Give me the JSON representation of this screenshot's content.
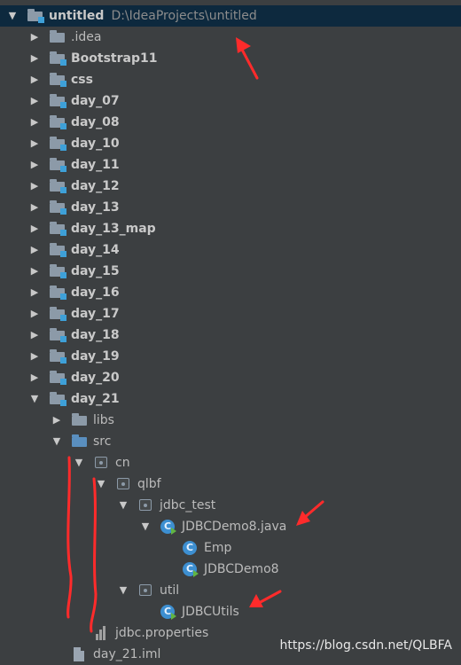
{
  "project": {
    "name": "untitled",
    "path": "D:\\IdeaProjects\\untitled"
  },
  "rows": [
    {
      "label": "untitled",
      "path": "D:\\IdeaProjects\\untitled",
      "depth": 0,
      "expanded": true,
      "icon": "module-folder-icon",
      "bold": true,
      "selected": true
    },
    {
      "label": ".idea",
      "depth": 1,
      "expanded": false,
      "icon": "folder-icon",
      "bold": false
    },
    {
      "label": "Bootstrap11",
      "depth": 1,
      "expanded": false,
      "icon": "module-folder-icon",
      "bold": true
    },
    {
      "label": "css",
      "depth": 1,
      "expanded": false,
      "icon": "module-folder-icon",
      "bold": true
    },
    {
      "label": "day_07",
      "depth": 1,
      "expanded": false,
      "icon": "module-folder-icon",
      "bold": true
    },
    {
      "label": "day_08",
      "depth": 1,
      "expanded": false,
      "icon": "module-folder-icon",
      "bold": true
    },
    {
      "label": "day_10",
      "depth": 1,
      "expanded": false,
      "icon": "module-folder-icon",
      "bold": true
    },
    {
      "label": "day_11",
      "depth": 1,
      "expanded": false,
      "icon": "module-folder-icon",
      "bold": true
    },
    {
      "label": "day_12",
      "depth": 1,
      "expanded": false,
      "icon": "module-folder-icon",
      "bold": true
    },
    {
      "label": "day_13",
      "depth": 1,
      "expanded": false,
      "icon": "module-folder-icon",
      "bold": true
    },
    {
      "label": "day_13_map",
      "depth": 1,
      "expanded": false,
      "icon": "module-folder-icon",
      "bold": true
    },
    {
      "label": "day_14",
      "depth": 1,
      "expanded": false,
      "icon": "module-folder-icon",
      "bold": true
    },
    {
      "label": "day_15",
      "depth": 1,
      "expanded": false,
      "icon": "module-folder-icon",
      "bold": true
    },
    {
      "label": "day_16",
      "depth": 1,
      "expanded": false,
      "icon": "module-folder-icon",
      "bold": true
    },
    {
      "label": "day_17",
      "depth": 1,
      "expanded": false,
      "icon": "module-folder-icon",
      "bold": true
    },
    {
      "label": "day_18",
      "depth": 1,
      "expanded": false,
      "icon": "module-folder-icon",
      "bold": true
    },
    {
      "label": "day_19",
      "depth": 1,
      "expanded": false,
      "icon": "module-folder-icon",
      "bold": true
    },
    {
      "label": "day_20",
      "depth": 1,
      "expanded": false,
      "icon": "module-folder-icon",
      "bold": true
    },
    {
      "label": "day_21",
      "depth": 1,
      "expanded": true,
      "icon": "module-folder-icon",
      "bold": true
    },
    {
      "label": "libs",
      "depth": 2,
      "expanded": false,
      "icon": "folder-icon",
      "bold": false
    },
    {
      "label": "src",
      "depth": 2,
      "expanded": true,
      "icon": "source-folder-icon",
      "bold": false
    },
    {
      "label": "cn",
      "depth": 3,
      "expanded": true,
      "icon": "package-icon",
      "bold": false
    },
    {
      "label": "qlbf",
      "depth": 4,
      "expanded": true,
      "icon": "package-icon",
      "bold": false
    },
    {
      "label": "jdbc_test",
      "depth": 5,
      "expanded": true,
      "icon": "package-icon",
      "bold": false
    },
    {
      "label": "JDBCDemo8.java",
      "depth": 6,
      "expanded": true,
      "icon": "java-class-run-icon",
      "bold": false
    },
    {
      "label": "Emp",
      "depth": 7,
      "expanded": null,
      "icon": "java-class-icon",
      "bold": false
    },
    {
      "label": "JDBCDemo8",
      "depth": 7,
      "expanded": null,
      "icon": "java-class-run-icon",
      "bold": false
    },
    {
      "label": "util",
      "depth": 5,
      "expanded": true,
      "icon": "package-icon",
      "bold": false
    },
    {
      "label": "JDBCUtils",
      "depth": 6,
      "expanded": null,
      "icon": "java-class-run-icon",
      "bold": false
    },
    {
      "label": "jdbc.properties",
      "depth": 3,
      "expanded": null,
      "icon": "properties-file-icon",
      "bold": false
    },
    {
      "label": "day_21.iml",
      "depth": 2,
      "expanded": null,
      "icon": "iml-file-icon",
      "bold": false
    }
  ],
  "watermark": "https://blog.csdn.net/QLBFA",
  "colors": {
    "background": "#3c3f41",
    "selection": "#0d293e",
    "annotation": "#ff2b2b",
    "class_icon": "#3d8fd1"
  }
}
